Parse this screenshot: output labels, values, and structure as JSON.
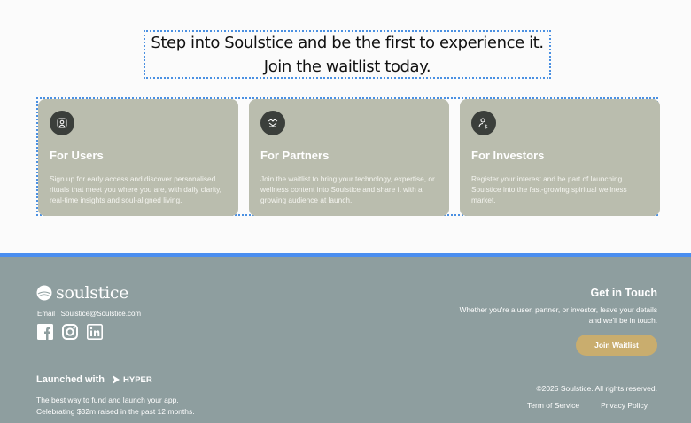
{
  "hero": {
    "line1": "Step into Soulstice and be the first to experience it.",
    "line2": "Join the waitlist today."
  },
  "cards": [
    {
      "icon": "user-icon",
      "title": "For Users",
      "description": "Sign up for early access and discover personalised rituals that meet you where you are, with daily clarity, real-time insights and soul-aligned living."
    },
    {
      "icon": "handshake-icon",
      "title": "For Partners",
      "description": "Join the waitlist to bring your technology, expertise, or wellness content into Soulstice and share it with a growing audience at launch."
    },
    {
      "icon": "investor-icon",
      "title": "For Investors",
      "description": "Register your interest and be part of launching Soulstice into the fast-growing spiritual wellness market."
    }
  ],
  "footer": {
    "brand": "soulstice",
    "email": "Email : Soulstice@Soulstice.com",
    "socials": [
      "facebook-icon",
      "instagram-icon",
      "linkedin-icon"
    ],
    "launched_with": "Launched with",
    "hyper": "HYPER",
    "tagline_1": "The best way to fund and launch your app.",
    "tagline_2": "Celebrating $32m raised in the past 12 months.",
    "get_in_touch": "Get in Touch",
    "get_in_touch_desc": "Whether you're a user, partner, or investor, leave your details and we'll be in touch.",
    "join_button": "Join Waitlist",
    "copyright": "©2025 Soulstice. All rights reserved.",
    "terms": "Term of Service",
    "privacy": "Privacy Policy"
  },
  "colors": {
    "card_bg": "#babdae",
    "footer_bg": "#8e9e9f",
    "accent_border": "#4a8ef0",
    "button_gold": "#c9ad6e"
  }
}
